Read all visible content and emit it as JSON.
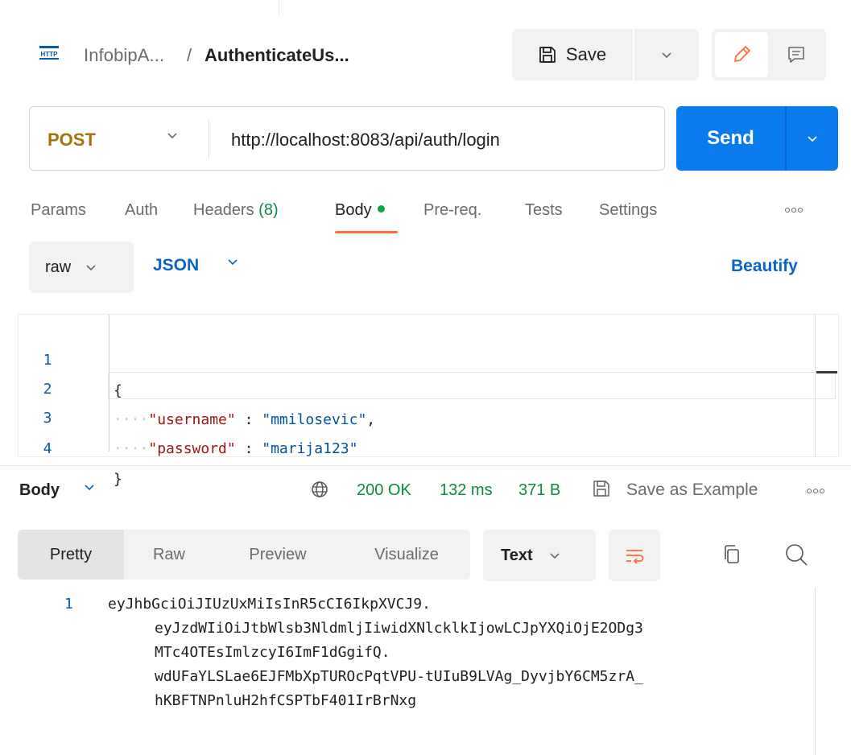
{
  "header": {
    "protocol_icon_text": "HTTP",
    "collection": "InfobipA...",
    "separator": "/",
    "request_name": "AuthenticateUs...",
    "save_label": "Save"
  },
  "request": {
    "method": "POST",
    "url": "http://localhost:8083/api/auth/login",
    "send_label": "Send"
  },
  "request_tabs": {
    "params": "Params",
    "auth": "Auth",
    "headers": "Headers",
    "headers_count": "(8)",
    "body": "Body",
    "prereq": "Pre-req.",
    "tests": "Tests",
    "settings": "Settings",
    "active": "Body"
  },
  "body_options": {
    "mode": "raw",
    "language": "JSON",
    "beautify_label": "Beautify"
  },
  "editor": {
    "lines": [
      {
        "num": "1",
        "text": "{"
      },
      {
        "num": "2",
        "key": "\"username\"",
        "colon": " : ",
        "value": "\"mmilosevic\"",
        "trail": ","
      },
      {
        "num": "3",
        "key": "\"password\"",
        "colon": " : ",
        "value": "\"marija123\"",
        "trail": ""
      },
      {
        "num": "4",
        "text": "}"
      }
    ]
  },
  "response": {
    "section_label": "Body",
    "status": "200 OK",
    "time": "132 ms",
    "size": "371 B",
    "save_example_label": "Save as Example",
    "view_tabs": [
      "Pretty",
      "Raw",
      "Preview",
      "Visualize"
    ],
    "active_view": "Pretty",
    "format": "Text",
    "line_number": "1",
    "content_lines": [
      "eyJhbGciOiJIUzUxMiIsInR5cCI6IkpXVCJ9.",
      "eyJzdWIiOiJtbWlsb3NldmljIiwidXNlcklkIjowLCJpYXQiOjE2ODg3",
      "MTc4OTEsImlzcyI6ImF1dGgifQ.",
      "wdUFaYLSLae6EJFMbXpTUROcPqtVPU-tUIuB9LVAg_DyvjbY6CM5zrA_",
      "hKBFTNPnluH2hfCSPTbF401IrBrNxg"
    ]
  },
  "colors": {
    "send_blue": "#097bed",
    "method_post": "#a6730a",
    "status_green": "#0f8a43",
    "active_tab_underline": "#ff6c37",
    "link_blue": "#0a63c7"
  }
}
